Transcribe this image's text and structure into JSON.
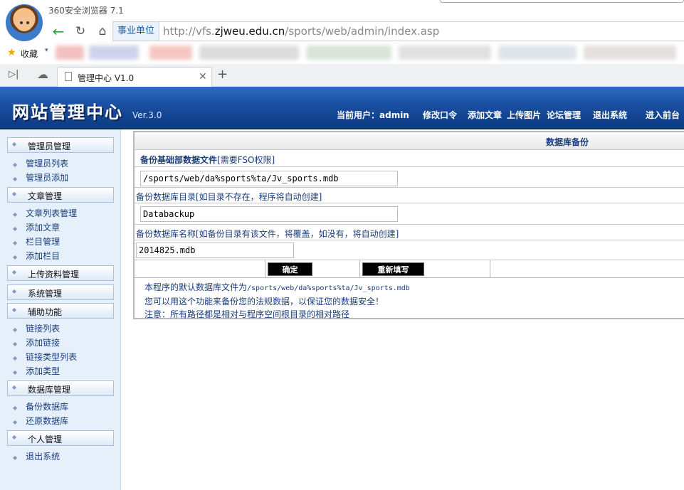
{
  "browser": {
    "title": "360安全浏览器 7.1",
    "site_label": "事业单位",
    "url_prefix": "http://vfs.",
    "url_domain": "zjweu.edu.cn",
    "url_path": "/sports/web/admin/index.asp",
    "bookmarks_label": "收藏",
    "tab_title": "管理中心 V1.0",
    "icons": [
      "back-icon",
      "reload-icon",
      "home-icon",
      "star-icon",
      "sidebar-toggle-icon",
      "cloud-icon",
      "document-icon",
      "close-icon",
      "plus-icon"
    ]
  },
  "site": {
    "logo": "网站管理中心",
    "version": "Ver.3.0",
    "nav": {
      "current_user": "当前用户：admin",
      "change_password": "修改口令",
      "add_article": "添加文章",
      "upload_image": "上传图片",
      "forum_manage": "论坛管理",
      "logout": "退出系统",
      "enter_front": "进入前台"
    }
  },
  "sidebar": {
    "groups": [
      {
        "title": "管理员管理",
        "items": [
          "管理员列表",
          "管理员添加"
        ]
      },
      {
        "title": "文章管理",
        "items": [
          "文章列表管理",
          "添加文章",
          "栏目管理",
          "添加栏目"
        ]
      },
      {
        "title": "上传资料管理",
        "items": []
      },
      {
        "title": "系统管理",
        "items": []
      },
      {
        "title": "辅助功能",
        "items": [
          "链接列表",
          "添加链接",
          "链接类型列表",
          "添加类型"
        ]
      },
      {
        "title": "数据库管理",
        "items": [
          "备份数据库",
          "还原数据库"
        ]
      },
      {
        "title": "个人管理",
        "items": [
          "退出系统"
        ]
      }
    ]
  },
  "main": {
    "title": "数据库备份",
    "label_source": "备份基础部数据文件",
    "label_source_note": "[需要FSO权限]",
    "source_value": "/sports/web/da%sports%ta/Jv_sports.mdb",
    "label_dir": "备份数据库目录[如目录不存在，程序将自动创建]",
    "dir_value": "Databackup",
    "label_name": "备份数据库名称[如备份目录有该文件，将覆盖，如没有，将自动创建]",
    "name_value": "2014825.mdb",
    "confirm_button": "确定",
    "reset_button": "重新填写",
    "note_default_prefix": "本程序的默认数据库文件为",
    "note_default_path": "/sports/web/da%sports%ta/Jv_sports.mdb",
    "note_backup": "您可以用这个功能来备份您的法规数据，以保证您的数据安全！",
    "note_path": "注意：所有路径都是相对与程序空间根目录的相对路径"
  }
}
